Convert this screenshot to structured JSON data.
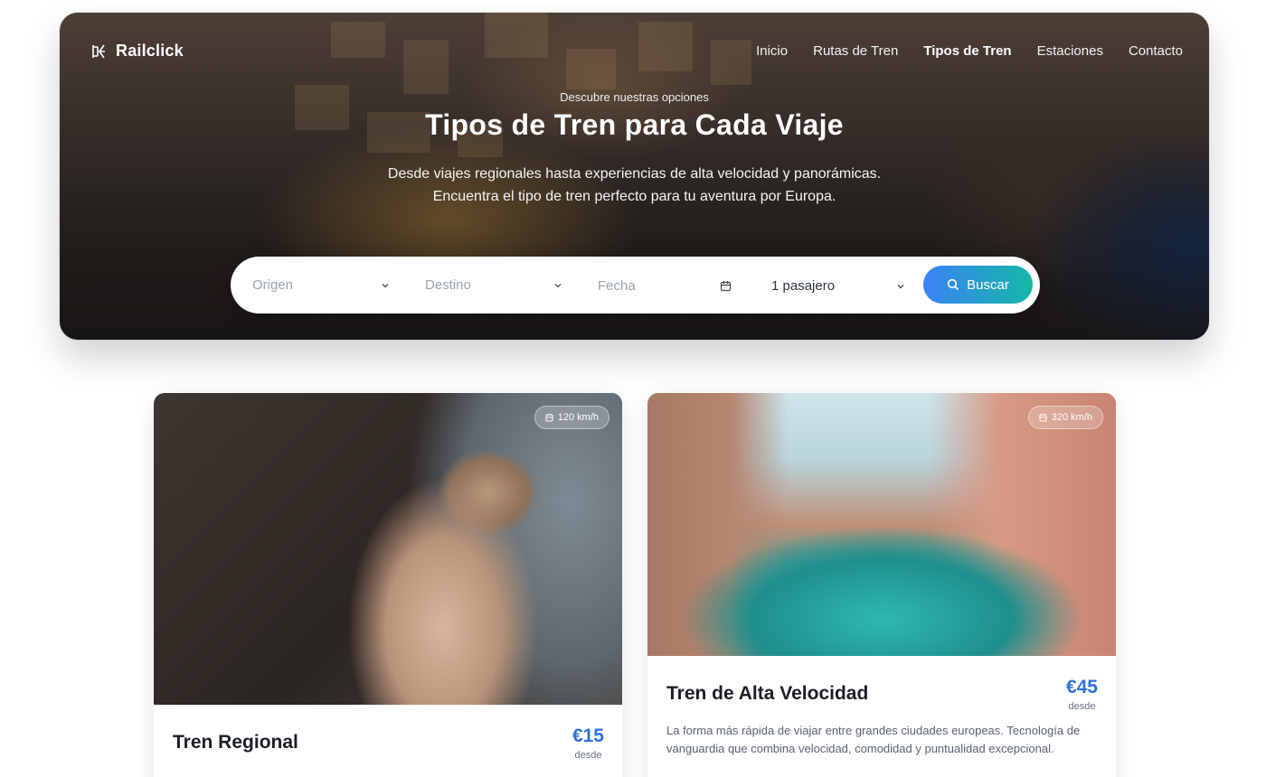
{
  "brand": {
    "name": "Railclick"
  },
  "nav": {
    "items": [
      {
        "label": "Inicio",
        "active": false
      },
      {
        "label": "Rutas de Tren",
        "active": false
      },
      {
        "label": "Tipos de Tren",
        "active": true
      },
      {
        "label": "Estaciones",
        "active": false
      },
      {
        "label": "Contacto",
        "active": false
      }
    ]
  },
  "hero": {
    "eyebrow": "Descubre nuestras opciones",
    "title": "Tipos de Tren para Cada Viaje",
    "subtitle_line1": "Desde viajes regionales hasta experiencias de alta velocidad y panorámicas.",
    "subtitle_line2": "Encuentra el tipo de tren perfecto para tu aventura por Europa."
  },
  "search": {
    "origin_placeholder": "Origen",
    "destination_placeholder": "Destino",
    "date_placeholder": "Fecha",
    "passengers_value": "1 pasajero",
    "button_label": "Buscar",
    "accent_start": "#3b82f6",
    "accent_end": "#14b8a6"
  },
  "cards": [
    {
      "title": "Tren Regional",
      "speed": "120 km/h",
      "price": "€15",
      "price_label": "desde",
      "description": "",
      "image": "david-statue-photo"
    },
    {
      "title": "Tren de Alta Velocidad",
      "speed": "320 km/h",
      "price": "€45",
      "price_label": "desde",
      "description_line1": "La forma más rápida de viajar entre grandes ciudades europeas. Tecnología de",
      "description_line2": "vanguardia que combina velocidad, comodidad y puntualidad excepcional.",
      "image": "venice-canal-photo"
    }
  ]
}
